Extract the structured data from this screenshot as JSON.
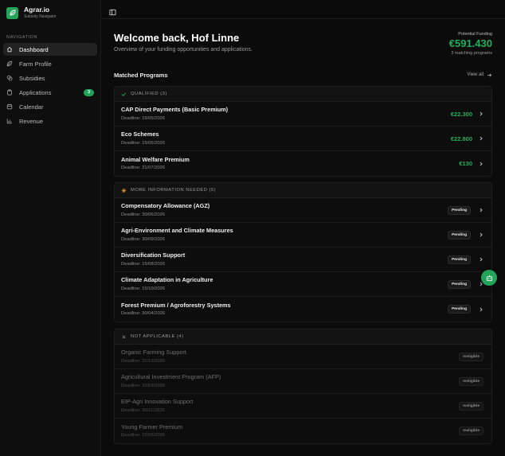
{
  "brand": {
    "name": "Agrar.io",
    "subtitle": "Subsidy Navigator"
  },
  "nav": {
    "heading": "NAVIGATION",
    "items": [
      {
        "label": "Dashboard",
        "icon": "home-icon",
        "active": true
      },
      {
        "label": "Farm Profile",
        "icon": "leaf-icon",
        "active": false
      },
      {
        "label": "Subsidies",
        "icon": "coins-icon",
        "active": false
      },
      {
        "label": "Applications",
        "icon": "clipboard-icon",
        "active": false,
        "badge": "3"
      },
      {
        "label": "Calendar",
        "icon": "calendar-icon",
        "active": false
      },
      {
        "label": "Revenue",
        "icon": "bar-chart-icon",
        "active": false
      }
    ]
  },
  "header": {
    "welcome": "Welcome back, Hof Linne",
    "subtitle": "Overview of your funding opportunities and applications."
  },
  "funding": {
    "label": "Potential Funding",
    "amount": "€591.430",
    "sub": "3 matching programs"
  },
  "matched": {
    "title": "Matched Programs",
    "view_all": "View all"
  },
  "groups": {
    "qualified": {
      "label": "QUALIFIED (3)",
      "rows": [
        {
          "title": "CAP Direct Payments (Basic Premium)",
          "deadline": "Deadline: 15/05/2026",
          "amount": "€22.300"
        },
        {
          "title": "Eco Schemes",
          "deadline": "Deadline: 15/05/2026",
          "amount": "€22.800"
        },
        {
          "title": "Animal Welfare Premium",
          "deadline": "Deadline: 31/07/2026",
          "amount": "€130"
        }
      ]
    },
    "more_info": {
      "label": "MORE INFORMATION NEEDED (5)",
      "rows": [
        {
          "title": "Compensatory Allowance (AGZ)",
          "deadline": "Deadline: 30/06/2026",
          "status": "Pending"
        },
        {
          "title": "Agri-Environment and Climate Measures",
          "deadline": "Deadline: 30/09/2026",
          "status": "Pending"
        },
        {
          "title": "Diversification Support",
          "deadline": "Deadline: 15/08/2026",
          "status": "Pending"
        },
        {
          "title": "Climate Adaptation in Agriculture",
          "deadline": "Deadline: 15/10/2026",
          "status": "Pending"
        },
        {
          "title": "Forest Premium / Agroforestry Systems",
          "deadline": "Deadline: 30/04/2026",
          "status": "Pending"
        }
      ]
    },
    "not_applicable": {
      "label": "NOT APPLICABLE (4)",
      "rows": [
        {
          "title": "Organic Farming Support",
          "deadline": "Deadline: 31/12/2026",
          "status": "Ineligible"
        },
        {
          "title": "Agricultural Investment Program (AFP)",
          "deadline": "Deadline: 31/03/2026",
          "status": "Ineligible"
        },
        {
          "title": "EIP-Agri Innovation Support",
          "deadline": "Deadline: 30/11/2026",
          "status": "Ineligible"
        },
        {
          "title": "Young Farmer Premium",
          "deadline": "Deadline: 15/05/2026",
          "status": "Ineligible"
        }
      ]
    }
  },
  "colors": {
    "accent": "#22a45a",
    "amount": "#22b05a",
    "warning": "#e0902a",
    "background": "#0b0b0b"
  }
}
